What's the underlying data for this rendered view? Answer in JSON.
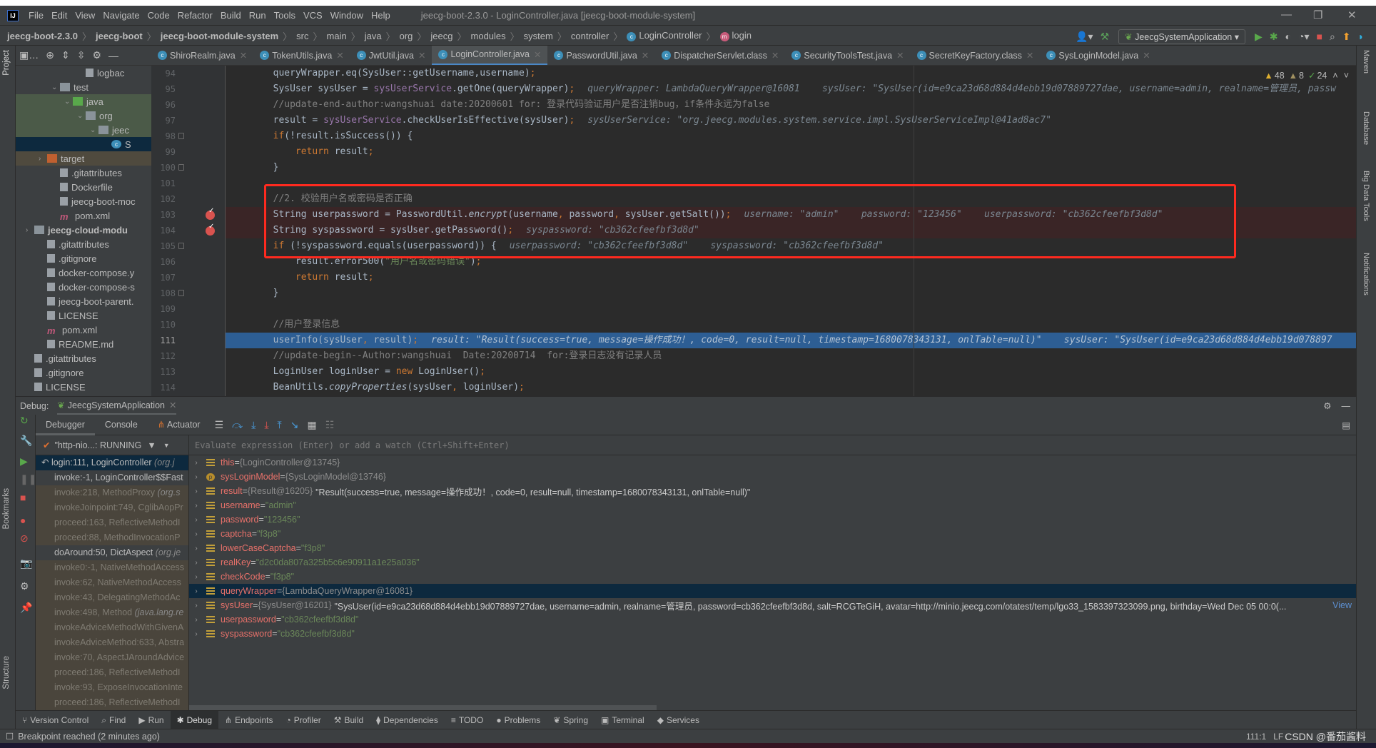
{
  "window": {
    "title": "jeecg-boot-2.3.0 - LoginController.java [jeecg-boot-module-system]",
    "logo": "IJ",
    "menu": [
      "File",
      "Edit",
      "View",
      "Navigate",
      "Code",
      "Refactor",
      "Build",
      "Run",
      "Tools",
      "VCS",
      "Window",
      "Help"
    ]
  },
  "breadcrumb": [
    {
      "label": "jeecg-boot-2.3.0",
      "bold": true
    },
    {
      "label": "jeecg-boot",
      "bold": true
    },
    {
      "label": "jeecg-boot-module-system",
      "bold": true
    },
    {
      "label": "src"
    },
    {
      "label": "main"
    },
    {
      "label": "java"
    },
    {
      "label": "org"
    },
    {
      "label": "jeecg"
    },
    {
      "label": "modules"
    },
    {
      "label": "system"
    },
    {
      "label": "controller"
    },
    {
      "label": "LoginController",
      "icon": "class-icon"
    },
    {
      "label": "login",
      "icon": "method-icon"
    }
  ],
  "run_config": "JeecgSystemApplication",
  "tabs": [
    {
      "label": "ShiroRealm.java"
    },
    {
      "label": "TokenUtils.java"
    },
    {
      "label": "JwtUtil.java"
    },
    {
      "label": "LoginController.java",
      "active": true
    },
    {
      "label": "PasswordUtil.java"
    },
    {
      "label": "DispatcherServlet.class"
    },
    {
      "label": "SecurityToolsTest.java"
    },
    {
      "label": "SecretKeyFactory.class"
    },
    {
      "label": "SysLoginModel.java"
    }
  ],
  "left_tools": {
    "project": "Project",
    "bookmarks": "Bookmarks",
    "structure": "Structure"
  },
  "right_tools": {
    "maven": "Maven",
    "database": "Database",
    "bigdata": "Big Data Tools",
    "notifications": "Notifications"
  },
  "project_tree": [
    {
      "label": "logbac",
      "depth": 5,
      "icon": "file"
    },
    {
      "label": "test",
      "depth": 3,
      "icon": "folder",
      "arrow": "open"
    },
    {
      "label": "java",
      "depth": 4,
      "icon": "folder-green",
      "arrow": "open",
      "style": "green"
    },
    {
      "label": "org",
      "depth": 5,
      "icon": "folder",
      "arrow": "open",
      "style": "green"
    },
    {
      "label": "jeec",
      "depth": 6,
      "icon": "folder",
      "arrow": "open",
      "style": "green"
    },
    {
      "label": "S",
      "depth": 7,
      "icon": "class",
      "style": "sel"
    },
    {
      "label": "target",
      "depth": 2,
      "icon": "folder-orange",
      "arrow": "closed",
      "style": "brown"
    },
    {
      "label": ".gitattributes",
      "depth": 3,
      "icon": "file"
    },
    {
      "label": "Dockerfile",
      "depth": 3,
      "icon": "file"
    },
    {
      "label": "jeecg-boot-moc",
      "depth": 3,
      "icon": "file"
    },
    {
      "label": "pom.xml",
      "depth": 3,
      "icon": "maven"
    },
    {
      "label": "jeecg-cloud-modu",
      "depth": 1,
      "icon": "folder",
      "arrow": "closed",
      "bold": true
    },
    {
      "label": ".gitattributes",
      "depth": 2,
      "icon": "file"
    },
    {
      "label": ".gitignore",
      "depth": 2,
      "icon": "file"
    },
    {
      "label": "docker-compose.y",
      "depth": 2,
      "icon": "file"
    },
    {
      "label": "docker-compose-s",
      "depth": 2,
      "icon": "file"
    },
    {
      "label": "jeecg-boot-parent.",
      "depth": 2,
      "icon": "file"
    },
    {
      "label": "LICENSE",
      "depth": 2,
      "icon": "file"
    },
    {
      "label": "pom.xml",
      "depth": 2,
      "icon": "maven"
    },
    {
      "label": "README.md",
      "depth": 2,
      "icon": "file"
    },
    {
      "label": ".gitattributes",
      "depth": 1,
      "icon": "file"
    },
    {
      "label": ".gitignore",
      "depth": 1,
      "icon": "file"
    },
    {
      "label": "LICENSE",
      "depth": 1,
      "icon": "file"
    }
  ],
  "inspections": {
    "warnings": "48",
    "weak_warnings": "8",
    "ok": "24"
  },
  "editor": {
    "lines": [
      {
        "n": "94",
        "tokens": [
          {
            "t": "        queryWrapper.eq(SysUser::getUsername,username)"
          },
          {
            "t": ";",
            "c": "k"
          }
        ]
      },
      {
        "n": "95",
        "tokens": [
          {
            "t": "        SysUser sysUser = "
          },
          {
            "t": "sysUserService",
            "c": "f"
          },
          {
            "t": ".getOne(queryWrapper)"
          },
          {
            "t": ";",
            "c": "k"
          }
        ],
        "hint": "queryWrapper: LambdaQueryWrapper@16081    sysUser: \"SysUser(id=e9ca23d68d884d4ebb19d07889727dae, username=admin, realname=管理员, passw"
      },
      {
        "n": "96",
        "tokens": [
          {
            "t": "        //update-end-author:wangshuai date:20200601 for: 登录代码验证用户是否注销bug，if条件永远为false",
            "c": "c"
          }
        ]
      },
      {
        "n": "97",
        "tokens": [
          {
            "t": "        result = "
          },
          {
            "t": "sysUserService",
            "c": "f"
          },
          {
            "t": ".checkUserIsEffective(sysUser)"
          },
          {
            "t": ";",
            "c": "k"
          }
        ],
        "hint": "sysUserService: \"org.jeecg.modules.system.service.impl.SysUserServiceImpl@41ad8ac7\""
      },
      {
        "n": "98",
        "tokens": [
          {
            "t": "        if",
            "c": "k"
          },
          {
            "t": "(!result.isSuccess()) {"
          }
        ],
        "fold": true
      },
      {
        "n": "99",
        "tokens": [
          {
            "t": "            return ",
            "c": "k"
          },
          {
            "t": "result"
          },
          {
            "t": ";",
            "c": "k"
          }
        ]
      },
      {
        "n": "100",
        "tokens": [
          {
            "t": "        }"
          }
        ],
        "fold": true
      },
      {
        "n": "101",
        "tokens": [
          {
            "t": ""
          }
        ]
      },
      {
        "n": "102",
        "tokens": [
          {
            "t": "        //2. 校验用户名或密码是否正确",
            "c": "c"
          }
        ]
      },
      {
        "n": "103",
        "tokens": [
          {
            "t": "        String userpassword = PasswordUtil."
          },
          {
            "t": "encrypt",
            "c": "i"
          },
          {
            "t": "(username"
          },
          {
            "t": ", ",
            "c": "k"
          },
          {
            "t": "password"
          },
          {
            "t": ", ",
            "c": "k"
          },
          {
            "t": "sysUser.getSalt())"
          },
          {
            "t": ";",
            "c": "k"
          }
        ],
        "hint": "username: \"admin\"    password: \"123456\"    userpassword: \"cb362cfeefbf3d8d\"",
        "breakpoint": true
      },
      {
        "n": "104",
        "tokens": [
          {
            "t": "        String syspassword = sysUser.getPassword()"
          },
          {
            "t": ";",
            "c": "k"
          }
        ],
        "hint": "syspassword: \"cb362cfeefbf3d8d\"",
        "breakpoint": true
      },
      {
        "n": "105",
        "tokens": [
          {
            "t": "        if ",
            "c": "k"
          },
          {
            "t": "(!syspassword.equals(userpassword)) {"
          }
        ],
        "hint": "userpassword: \"cb362cfeefbf3d8d\"    syspassword: \"cb362cfeefbf3d8d\"",
        "fold": true
      },
      {
        "n": "106",
        "tokens": [
          {
            "t": "            result.error500("
          },
          {
            "t": "\"用户名或密码错误\"",
            "c": "s"
          },
          {
            "t": ")"
          },
          {
            "t": ";",
            "c": "k"
          }
        ]
      },
      {
        "n": "107",
        "tokens": [
          {
            "t": "            return ",
            "c": "k"
          },
          {
            "t": "result"
          },
          {
            "t": ";",
            "c": "k"
          }
        ]
      },
      {
        "n": "108",
        "tokens": [
          {
            "t": "        }"
          }
        ],
        "fold": true
      },
      {
        "n": "109",
        "tokens": [
          {
            "t": ""
          }
        ]
      },
      {
        "n": "110",
        "tokens": [
          {
            "t": "        //用户登录信息",
            "c": "c"
          }
        ]
      },
      {
        "n": "111",
        "tokens": [
          {
            "t": "        userInfo(sysUser"
          },
          {
            "t": ", ",
            "c": "k"
          },
          {
            "t": "result)"
          },
          {
            "t": ";",
            "c": "k"
          }
        ],
        "hint": "result: \"Result(success=true, message=操作成功！, code=0, result=null, timestamp=1680078343131, onlTable=null)\"    sysUser: \"SysUser(id=e9ca23d68d884d4ebb19d078897",
        "current": true
      },
      {
        "n": "112",
        "tokens": [
          {
            "t": "        //update-begin--Author:wangshuai  Date:20200714  for:登录日志没有记录人员",
            "c": "c"
          }
        ]
      },
      {
        "n": "113",
        "tokens": [
          {
            "t": "        LoginUser loginUser = "
          },
          {
            "t": "new ",
            "c": "k"
          },
          {
            "t": "LoginUser()"
          },
          {
            "t": ";",
            "c": "k"
          }
        ]
      },
      {
        "n": "114",
        "tokens": [
          {
            "t": "        BeanUtils."
          },
          {
            "t": "copyProperties",
            "c": "i"
          },
          {
            "t": "(sysUser"
          },
          {
            "t": ", ",
            "c": "k"
          },
          {
            "t": "loginUser)"
          },
          {
            "t": ";",
            "c": "k"
          }
        ]
      }
    ]
  },
  "debug": {
    "label": "Debug:",
    "session": "JeecgSystemApplication",
    "tabs": [
      "Debugger",
      "Console",
      "Actuator"
    ],
    "thread": "\"http-nio...: RUNNING",
    "eval_placeholder": "Evaluate expression (Enter) or add a watch (Ctrl+Shift+Enter)",
    "frames": [
      {
        "text": "login:111, LoginController ",
        "pkg": "(org.j",
        "state": "sel"
      },
      {
        "text": "invoke:-1, LoginController$$Fast"
      },
      {
        "text": "invoke:218, MethodProxy ",
        "pkg": "(org.s",
        "state": "lib"
      },
      {
        "text": "invokeJoinpoint:749, CglibAopPr",
        "state": "lib"
      },
      {
        "text": "proceed:163, ReflectiveMethodI",
        "state": "lib"
      },
      {
        "text": "proceed:88, MethodInvocationP",
        "state": "lib"
      },
      {
        "text": "doAround:50, DictAspect ",
        "pkg": "(org.je"
      },
      {
        "text": "invoke0:-1, NativeMethodAccess",
        "state": "lib"
      },
      {
        "text": "invoke:62, NativeMethodAccess",
        "state": "lib"
      },
      {
        "text": "invoke:43, DelegatingMethodAc",
        "state": "lib"
      },
      {
        "text": "invoke:498, Method ",
        "pkg": "(java.lang.re",
        "state": "lib"
      },
      {
        "text": "invokeAdviceMethodWithGivenA",
        "state": "lib"
      },
      {
        "text": "invokeAdviceMethod:633, Abstra",
        "state": "lib"
      },
      {
        "text": "invoke:70, AspectJAroundAdvice",
        "state": "lib"
      },
      {
        "text": "proceed:186, ReflectiveMethodI",
        "state": "lib"
      },
      {
        "text": "invoke:93, ExposeInvocationInte",
        "state": "lib"
      },
      {
        "text": "proceed:186, ReflectiveMethodI",
        "state": "lib"
      }
    ],
    "variables": [
      {
        "name": "this",
        "type": "{LoginController@13745}"
      },
      {
        "name": "sysLoginModel",
        "type": "{SysLoginModel@13746}",
        "icon": "param"
      },
      {
        "name": "result",
        "type": "{Result@16205}",
        "value": "\"Result(success=true, message=操作成功！, code=0, result=null, timestamp=1680078343131, onlTable=null)\""
      },
      {
        "name": "username",
        "str": "\"admin\""
      },
      {
        "name": "password",
        "str": "\"123456\""
      },
      {
        "name": "captcha",
        "str": "\"f3p8\""
      },
      {
        "name": "lowerCaseCaptcha",
        "str": "\"f3p8\""
      },
      {
        "name": "realKey",
        "str": "\"d2c0da807a325b5c6e90911a1e25a036\""
      },
      {
        "name": "checkCode",
        "str": "\"f3p8\""
      },
      {
        "name": "queryWrapper",
        "type": "{LambdaQueryWrapper@16081}",
        "selected": true
      },
      {
        "name": "sysUser",
        "type": "{SysUser@16201}",
        "value": "\"SysUser(id=e9ca23d68d884d4ebb19d07889727dae, username=admin, realname=管理员, password=cb362cfeefbf3d8d, salt=RCGTeGiH, avatar=http://minio.jeecg.com/otatest/temp/lgo33_1583397323099.png, birthday=Wed Dec 05 00:0(...",
        "link": "View"
      },
      {
        "name": "userpassword",
        "str": "\"cb362cfeefbf3d8d\""
      },
      {
        "name": "syspassword",
        "str": "\"cb362cfeefbf3d8d\""
      }
    ],
    "eq": " = "
  },
  "bottom_tools": [
    {
      "label": "Version Control",
      "icon": "⑂"
    },
    {
      "label": "Find",
      "icon": "⌕"
    },
    {
      "label": "Run",
      "icon": "▶"
    },
    {
      "label": "Debug",
      "icon": "✱",
      "active": true
    },
    {
      "label": "Endpoints",
      "icon": "⋔"
    },
    {
      "label": "Profiler",
      "icon": "◔"
    },
    {
      "label": "Build",
      "icon": "⚒"
    },
    {
      "label": "Dependencies",
      "icon": "⧫"
    },
    {
      "label": "TODO",
      "icon": "≡"
    },
    {
      "label": "Problems",
      "icon": "●"
    },
    {
      "label": "Spring",
      "icon": "❦"
    },
    {
      "label": "Terminal",
      "icon": "▣"
    },
    {
      "label": "Services",
      "icon": "◆"
    }
  ],
  "status": {
    "message": "Breakpoint reached (2 minutes ago)",
    "position": "111:1",
    "line_sep": "LF",
    "watermark": "CSDN @番茄酱料"
  },
  "colors": {
    "accent": "#4a88c7",
    "highlight_box": "#ff2a1f",
    "breakpoint": "#d9534f",
    "current_line": "#2d5e94"
  }
}
